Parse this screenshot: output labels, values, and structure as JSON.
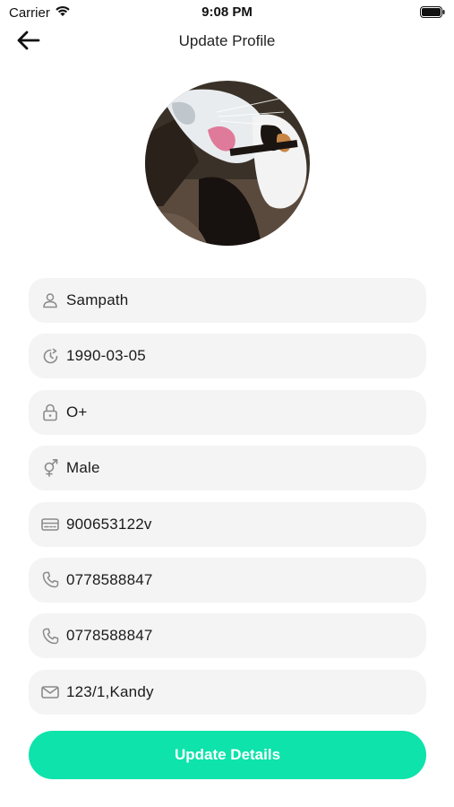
{
  "status_bar": {
    "carrier": "Carrier",
    "time": "9:08 PM",
    "icons": [
      "wifi-icon",
      "battery-icon"
    ]
  },
  "nav": {
    "title": "Update Profile",
    "back_icon": "arrow-left-icon"
  },
  "profile": {
    "avatar_description_icon": "avatar-photo"
  },
  "fields": [
    {
      "icon": "person-icon",
      "value": "Sampath"
    },
    {
      "icon": "calendar-clock-icon",
      "value": "1990-03-05"
    },
    {
      "icon": "lock-icon",
      "value": "O+"
    },
    {
      "icon": "gender-icon",
      "value": "Male"
    },
    {
      "icon": "id-card-icon",
      "value": "900653122v"
    },
    {
      "icon": "phone-icon",
      "value": "0778588847"
    },
    {
      "icon": "phone-icon",
      "value": "0778588847"
    },
    {
      "icon": "mail-icon",
      "value": "123/1,Kandy"
    }
  ],
  "actions": {
    "update_label": "Update Details"
  },
  "colors": {
    "accent": "#0de3ab",
    "field_bg": "#f4f4f4",
    "icon_gray": "#8a8a8a"
  }
}
